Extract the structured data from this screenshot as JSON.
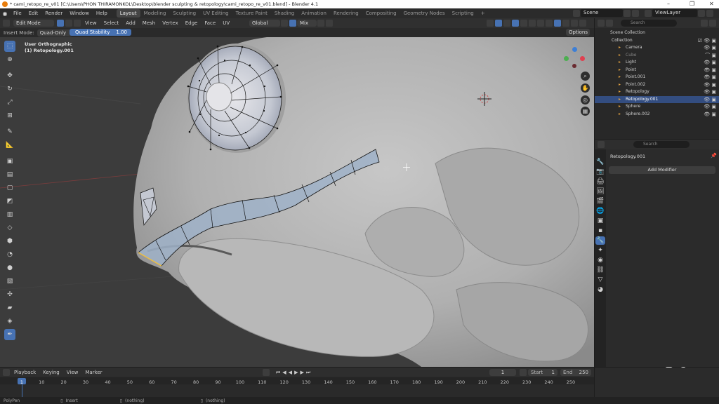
{
  "window": {
    "title": "* cami_retopo_re_v01 [C:\\Users\\PHON THIRAMONKOL\\Desktop\\blender sculpting & retopology\\cami_retopo_re_v01.blend] - Blender 4.1",
    "minimize": "–",
    "maximize": "❐",
    "close": "✕"
  },
  "menu": [
    "File",
    "Edit",
    "Render",
    "Window",
    "Help"
  ],
  "workspaces": [
    "Layout",
    "Modeling",
    "Sculpting",
    "UV Editing",
    "Texture Paint",
    "Shading",
    "Animation",
    "Rendering",
    "Compositing",
    "Geometry Nodes",
    "Scripting"
  ],
  "add_workspace": "+",
  "scene_label": "Scene",
  "viewlayer_label": "ViewLayer",
  "viewport_header": {
    "mode": "Edit Mode",
    "menus": [
      "View",
      "Select",
      "Add",
      "Mesh",
      "Vertex",
      "Edge",
      "Face",
      "UV"
    ],
    "orientation": "Global",
    "snap": "Mix",
    "options": "Options"
  },
  "tool_header": {
    "insert_mode_label": "Insert Mode:",
    "insert_mode_value": "Quad-Only",
    "quad_stability_label": "Quad Stability",
    "quad_stability_value": "1.00"
  },
  "viewport": {
    "view_name": "User Orthographic",
    "object_name": "(1) Retopology.001"
  },
  "outliner": {
    "search_placeholder": "Search",
    "root": "Scene Collection",
    "collection": "Collection",
    "items": [
      {
        "name": "Camera",
        "color": "#e0a040"
      },
      {
        "name": "Cube",
        "color": "#e0a040"
      },
      {
        "name": "Light",
        "color": "#e0a040"
      },
      {
        "name": "Point",
        "color": "#e0a040"
      },
      {
        "name": "Point.001",
        "color": "#e0a040"
      },
      {
        "name": "Point.002",
        "color": "#e0a040"
      },
      {
        "name": "Retopology",
        "color": "#e0a040"
      },
      {
        "name": "Retopology.001",
        "color": "#e0a040"
      },
      {
        "name": "Sphere",
        "color": "#e0a040"
      },
      {
        "name": "Sphere.002",
        "color": "#e0a040"
      }
    ]
  },
  "properties": {
    "search_placeholder": "Search",
    "object_name": "Retopology.001",
    "add_modifier": "Add Modifier"
  },
  "timeline": {
    "menus": [
      "Playback",
      "Keying",
      "View",
      "Marker"
    ],
    "current_frame": "1",
    "start_label": "Start",
    "start_value": "1",
    "end_label": "End",
    "end_value": "250",
    "frames": [
      "1",
      "10",
      "20",
      "30",
      "40",
      "50",
      "60",
      "70",
      "80",
      "90",
      "100",
      "110",
      "120",
      "130",
      "140",
      "150",
      "160",
      "170",
      "180",
      "190",
      "200",
      "210",
      "220",
      "230",
      "240",
      "250"
    ]
  },
  "statusbar": {
    "tool": "PolyPen",
    "insert": "Insert",
    "nothing1": "(nothing)",
    "nothing2": "(nothing)"
  },
  "colors": {
    "accent": "#4772b3",
    "selection_row": "#334d80",
    "orange": "#e87d0d"
  }
}
